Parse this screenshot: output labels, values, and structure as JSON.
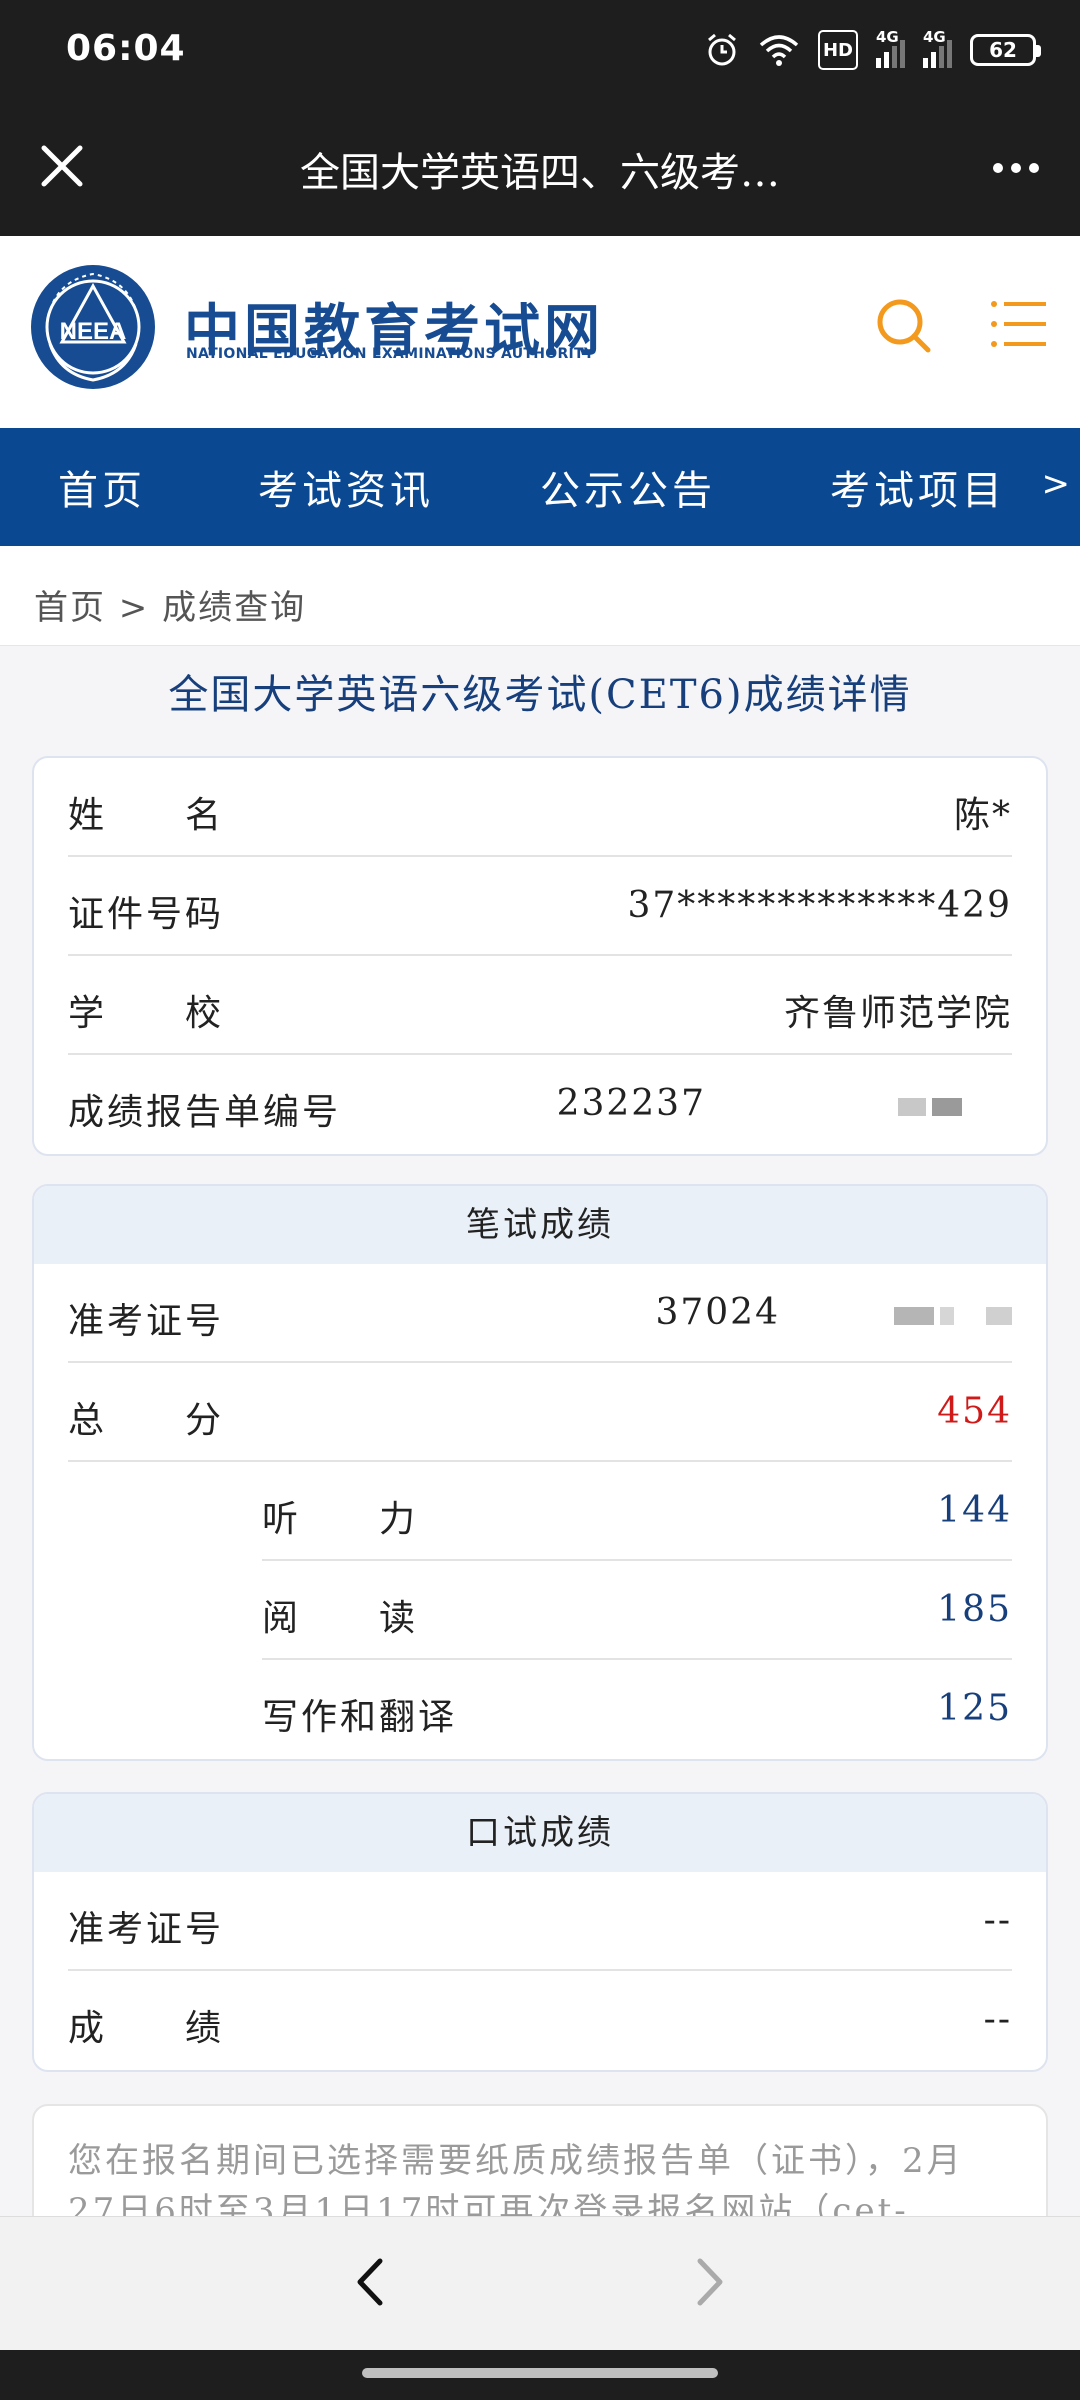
{
  "status_bar": {
    "time": "06:04",
    "hd_label": "HD",
    "network_1": "4G",
    "network_2": "4G",
    "battery": "62",
    "icons": [
      "alarm-icon",
      "wifi-icon",
      "hd-icon",
      "signal-icon",
      "signal-icon",
      "battery-icon"
    ]
  },
  "title_bar": {
    "title": "全国大学英语四、六级考…",
    "close_icon": "close-icon",
    "more_icon": "more-icon"
  },
  "site": {
    "logo_cn": "中国教育考试网",
    "logo_en": "NATIONAL EDUCATION EXAMINATIONS AUTHORITY",
    "emblem_text": "NEEA",
    "accent_color": "#f39a1e",
    "brand_color": "#0b4892"
  },
  "nav": {
    "items": [
      "首页",
      "考试资讯",
      "公示公告",
      "考试项目"
    ],
    "more": ">"
  },
  "breadcrumb": "首页 > 成绩查询",
  "detail": {
    "title": "全国大学英语六级考试(CET6)成绩详情",
    "personal": {
      "name_label": "姓　　名",
      "name_value": "陈*",
      "id_label": "证件号码",
      "id_value": "37*************429",
      "school_label": "学　　校",
      "school_value": "齐鲁师范学院",
      "report_label": "成绩报告单编号",
      "report_value": "232237"
    },
    "written": {
      "header": "笔试成绩",
      "ticket_label": "准考证号",
      "ticket_value": "37024",
      "total_label": "总　　分",
      "total_value": "454",
      "listening_label": "听　　力",
      "listening_value": "144",
      "reading_label": "阅　　读",
      "reading_value": "185",
      "writing_label": "写作和翻译",
      "writing_value": "125"
    },
    "oral": {
      "header": "口试成绩",
      "ticket_label": "准考证号",
      "ticket_value": "--",
      "score_label": "成　　绩",
      "score_value": "--"
    },
    "notice": "您在报名期间已选择需要纸质成绩报告单（证书），2月27日6时至3月1日17时可再次登录报名网站（cet-"
  },
  "bottom_nav": {
    "back_icon": "chevron-left-icon",
    "forward_icon": "chevron-right-icon"
  }
}
